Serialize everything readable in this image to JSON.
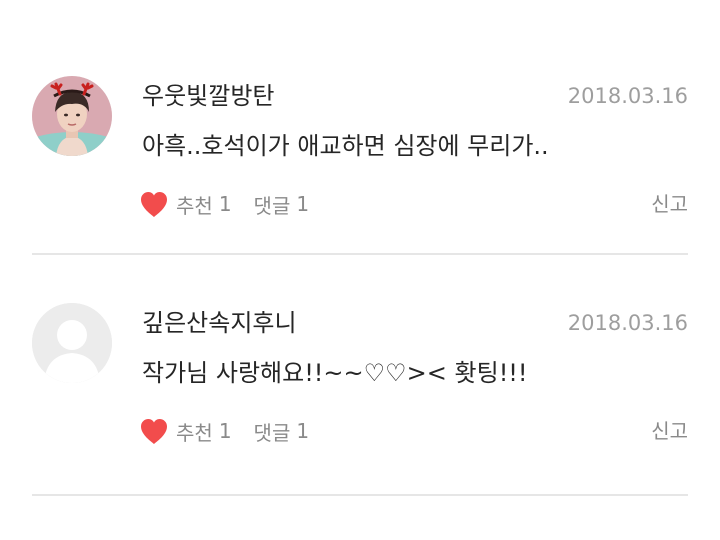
{
  "comments": [
    {
      "author": "우웃빛깔방탄",
      "date": "2018.03.16",
      "text": "아흑..호석이가 애교하면 심장에 무리가..",
      "like_label": "추천",
      "like_count": "1",
      "reply_label": "댓글",
      "reply_count": "1",
      "report_label": "신고",
      "avatar": "user-photo",
      "heart_color": "#f24c4c"
    },
    {
      "author": "깊은산속지후니",
      "date": "2018.03.16",
      "text": "작가님 사랑해요!!~~♡♡>< 홧팅!!!",
      "like_label": "추천",
      "like_count": "1",
      "reply_label": "댓글",
      "reply_count": "1",
      "report_label": "신고",
      "avatar": "default-user-silhouette",
      "heart_color": "#f24c4c"
    }
  ]
}
